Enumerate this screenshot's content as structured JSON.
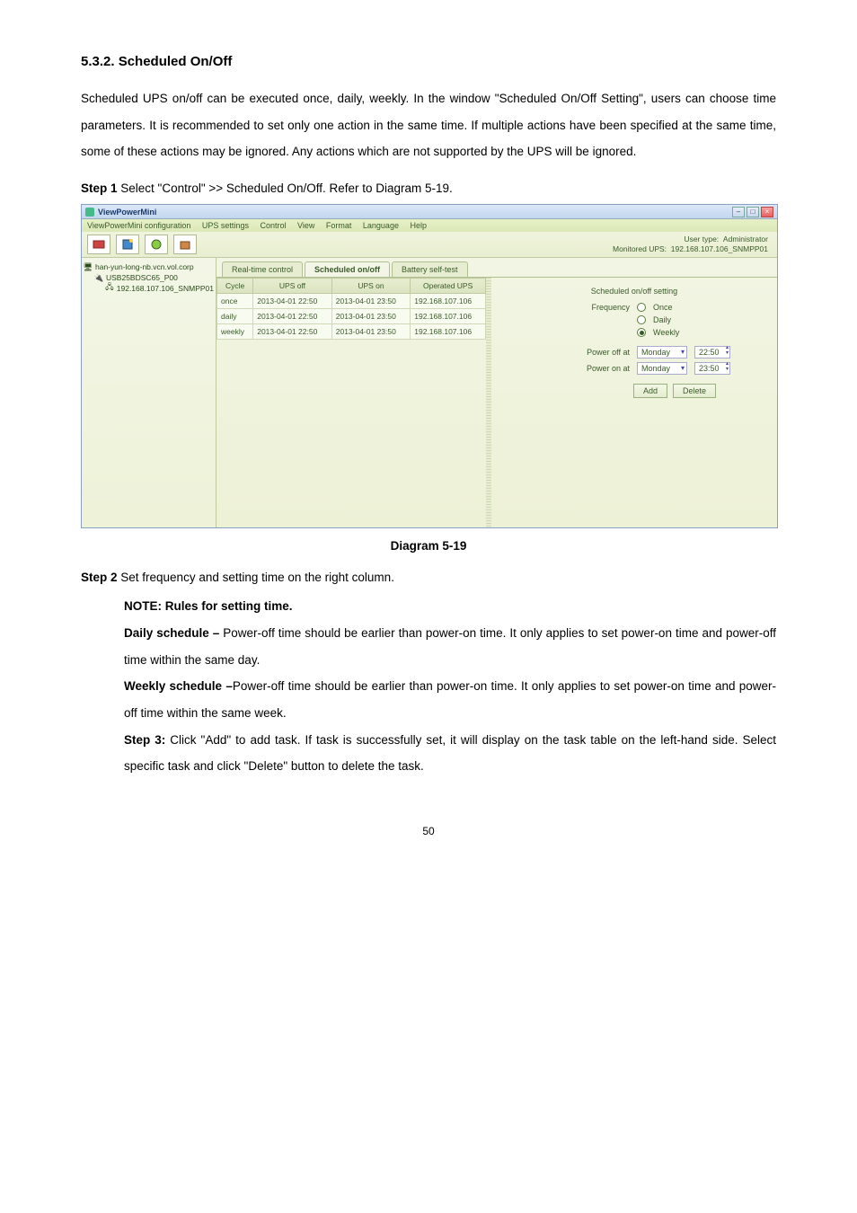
{
  "section": {
    "heading": "5.3.2. Scheduled On/Off"
  },
  "para1": "Scheduled UPS on/off can be executed once, daily, weekly. In the window \"Scheduled On/Off Setting\", users can choose time parameters. It is recommended to set only one action in the same time.  If multiple actions have been specified at the same time, some of these actions may be ignored. Any actions which are not supported by the UPS will be ignored.",
  "step1": {
    "label": "Step 1",
    "text": "  Select \"Control\" >> Scheduled On/Off. Refer to Diagram 5-19."
  },
  "fig": {
    "caption": "Diagram 5-19"
  },
  "step2": {
    "label": "Step 2",
    "text": "  Set frequency and setting time on the right column."
  },
  "notes": {
    "rules": "NOTE: Rules for setting time.",
    "daily_label": "Daily schedule –",
    "daily_text": " Power-off time should be earlier than power-on time. It only applies to set power-on time and power-off time within the same day.",
    "weekly_label": "Weekly schedule –",
    "weekly_text": "Power-off time should be earlier than power-on time. It only applies to set power-on time and power-off time within the same week.",
    "step3_label": "Step 3:",
    "step3_text": " Click \"Add\" to add task. If task is successfully set, it will display on the task table on the left-hand side. Select specific task and click \"Delete\" button to delete the task."
  },
  "page": "50",
  "app": {
    "title": "ViewPowerMini",
    "menus": [
      "ViewPowerMini configuration",
      "UPS settings",
      "Control",
      "View",
      "Format",
      "Language",
      "Help"
    ],
    "user_type_label": "User type:",
    "user_type": "Administrator",
    "monitored_label": "Monitored UPS:",
    "monitored": "192.168.107.106_SNMPP01",
    "tree": {
      "root": "han-yun-long-nb.vcn.vol.corp",
      "child1": "USB25BDSC65_P00",
      "child2": "192.168.107.106_SNMPP01"
    },
    "tabs": {
      "t1": "Real-time control",
      "t2": "Scheduled on/off",
      "t3": "Battery self-test"
    },
    "table": {
      "headers": [
        "Cycle",
        "UPS off",
        "UPS on",
        "Operated UPS"
      ],
      "rows": [
        [
          "once",
          "2013-04-01 22:50",
          "2013-04-01 23:50",
          "192.168.107.106"
        ],
        [
          "daily",
          "2013-04-01 22:50",
          "2013-04-01 23:50",
          "192.168.107.106"
        ],
        [
          "weekly",
          "2013-04-01 22:50",
          "2013-04-01 23:50",
          "192.168.107.106"
        ]
      ]
    },
    "form": {
      "title": "Scheduled on/off setting",
      "freq_label": "Frequency",
      "opts": {
        "once": "Once",
        "daily": "Daily",
        "weekly": "Weekly"
      },
      "poweroff_label": "Power off at",
      "poweron_label": "Power on at",
      "day": "Monday",
      "time_off": "22:50",
      "time_on": "23:50",
      "add": "Add",
      "delete": "Delete"
    }
  }
}
